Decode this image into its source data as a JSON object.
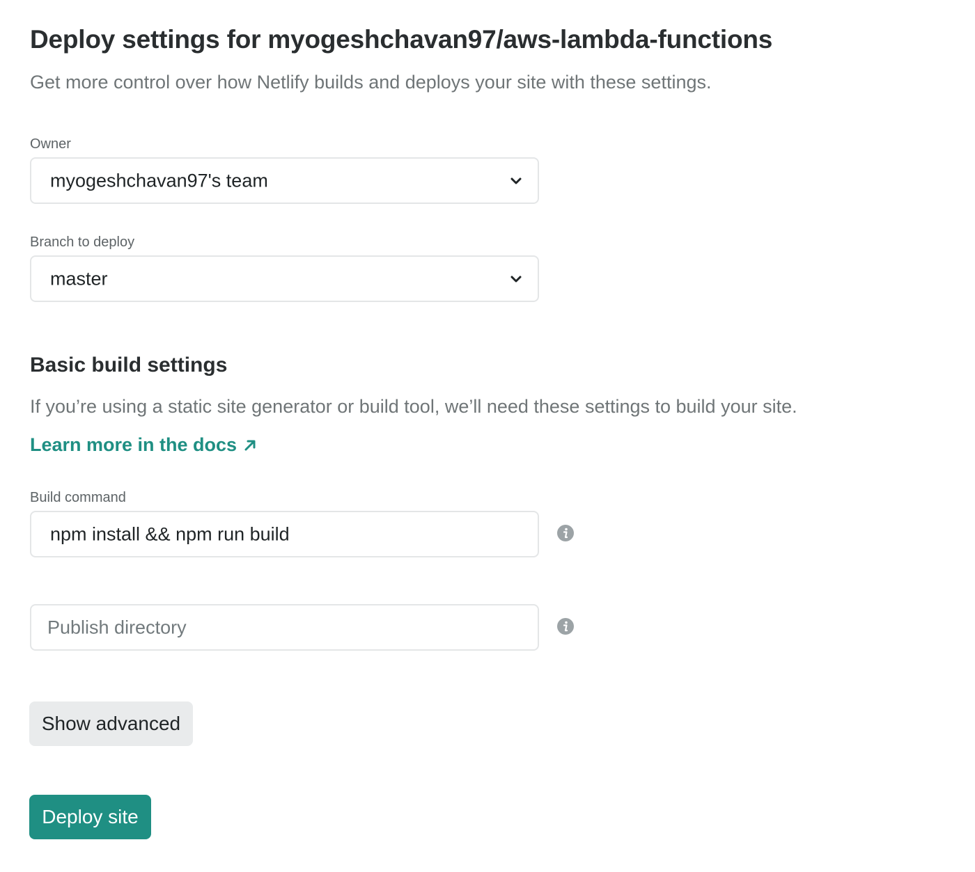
{
  "header": {
    "title": "Deploy settings for myogeshchavan97/aws-lambda-functions",
    "subtitle": "Get more control over how Netlify builds and deploys your site with these settings."
  },
  "owner": {
    "label": "Owner",
    "selected": "myogeshchavan97's team",
    "chevron_icon": "chevron-down-icon"
  },
  "branch": {
    "label": "Branch to deploy",
    "selected": "master",
    "chevron_icon": "chevron-down-icon"
  },
  "build_settings": {
    "heading": "Basic build settings",
    "description": "If you’re using a static site generator or build tool, we’ll need these settings to build your site.",
    "docs_link": "Learn more in the docs",
    "docs_link_icon": "external-arrow-icon",
    "build_command": {
      "label": "Build command",
      "value": "npm install && npm run build",
      "info_icon": "info-icon"
    },
    "publish_directory": {
      "value": "",
      "placeholder": "Publish directory",
      "info_icon": "info-icon"
    }
  },
  "buttons": {
    "show_advanced": "Show advanced",
    "deploy_site": "Deploy site"
  },
  "colors": {
    "accent": "#1f8f83",
    "text_dark": "#2a2e30",
    "text_muted": "#6f7577",
    "input_border": "#e4e6e7",
    "secondary_button_bg": "#e9ebec",
    "info_icon": "#9ca3a6"
  }
}
